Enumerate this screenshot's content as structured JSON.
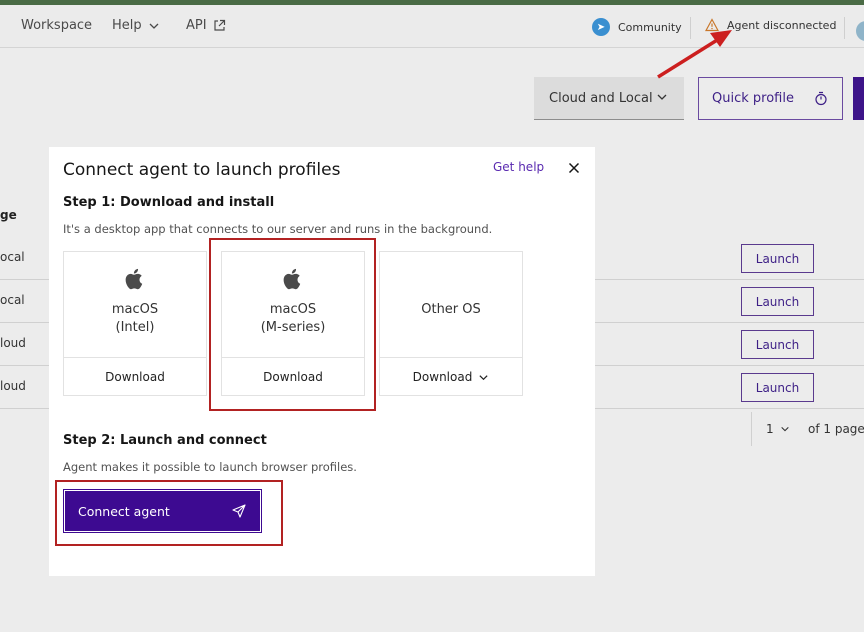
{
  "topnav": {
    "items": [
      {
        "label": "Workspace"
      },
      {
        "label": "Help"
      },
      {
        "label": "API"
      }
    ],
    "community_label": "Community",
    "agent_status": "Agent disconnected"
  },
  "toolbar": {
    "mode_select": "Cloud and Local",
    "quick_profile": "Quick profile"
  },
  "table": {
    "column_header": "ge",
    "rows": [
      {
        "cell": "ocal",
        "action": "Launch"
      },
      {
        "cell": "ocal",
        "action": "Launch"
      },
      {
        "cell": "loud",
        "action": "Launch"
      },
      {
        "cell": "loud",
        "action": "Launch"
      }
    ],
    "pager": {
      "page": "1",
      "text": "of 1 page"
    }
  },
  "modal": {
    "title": "Connect agent to launch profiles",
    "help_link": "Get help",
    "step1": {
      "title": "Step 1: Download and install",
      "description": "It's a desktop app that connects to our server and runs in the background.",
      "options": [
        {
          "line1": "macOS",
          "line2": "(Intel)",
          "action": "Download",
          "icon": "apple-icon"
        },
        {
          "line1": "macOS",
          "line2": "(M-series)",
          "action": "Download",
          "icon": "apple-icon"
        },
        {
          "line1": "Other OS",
          "line2": "",
          "action": "Download",
          "icon": ""
        }
      ]
    },
    "step2": {
      "title": "Step 2: Launch and connect",
      "description": "Agent makes it possible to launch browser profiles.",
      "button": "Connect agent"
    }
  },
  "colors": {
    "primary": "#3d0a91",
    "link": "#5a2ab0",
    "highlight": "#b22222"
  }
}
